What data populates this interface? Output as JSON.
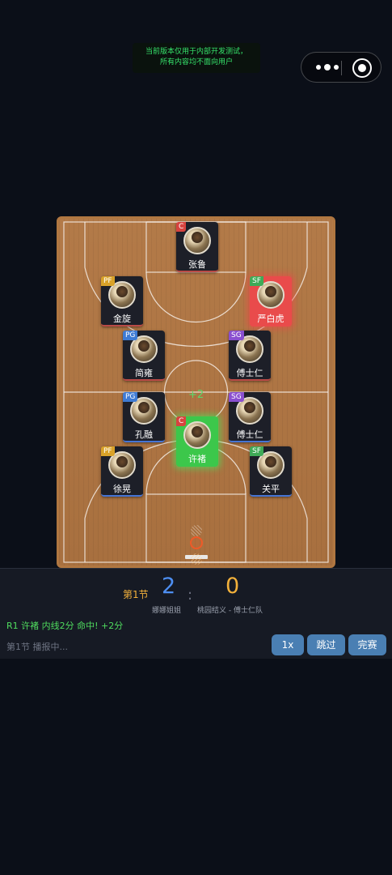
{
  "dev_notice": {
    "line1": "当前版本仅用于内部开发测试，",
    "line2": "所有内容均不面向用户"
  },
  "court": {
    "score_popup": "+2",
    "players": [
      {
        "key": "zhang-lu",
        "name": "张鲁",
        "position": "C",
        "team": "home",
        "highlight": "none"
      },
      {
        "key": "jin-xuan",
        "name": "金旋",
        "position": "PF",
        "team": "home",
        "highlight": "none"
      },
      {
        "key": "yan-baihu",
        "name": "严白虎",
        "position": "SF",
        "team": "home",
        "highlight": "red"
      },
      {
        "key": "jian-yong",
        "name": "简雍",
        "position": "PG",
        "team": "home",
        "highlight": "none"
      },
      {
        "key": "fu-shiren-top",
        "name": "傅士仁",
        "position": "SG",
        "team": "home",
        "highlight": "none"
      },
      {
        "key": "kong-rong",
        "name": "孔融",
        "position": "PG",
        "team": "away",
        "highlight": "none"
      },
      {
        "key": "fu-shiren-bottom",
        "name": "傅士仁",
        "position": "SG",
        "team": "away",
        "highlight": "none"
      },
      {
        "key": "xu-chu",
        "name": "许褚",
        "position": "C",
        "team": "away",
        "highlight": "green"
      },
      {
        "key": "xu-huang",
        "name": "徐晃",
        "position": "PF",
        "team": "away",
        "highlight": "none"
      },
      {
        "key": "guan-ping",
        "name": "关平",
        "position": "SF",
        "team": "away",
        "highlight": "none"
      }
    ]
  },
  "scoreboard": {
    "quarter": "第1节",
    "home_score": "2",
    "separator": ":",
    "away_score": "0",
    "home_team": "娜娜姐姐",
    "away_team": "桃园结义 - 傅士仁队",
    "last_event": "R1 许褚 内线2分 命中! +2分",
    "status": "第1节 播报中..."
  },
  "controls": {
    "speed_label": "1x",
    "skip_label": "跳过",
    "finish_label": "完赛"
  },
  "colors": {
    "home_score": "#4e8ff2",
    "away_score": "#f3b13b",
    "event_text": "#4fdc5e",
    "button": "#4a7fb3"
  }
}
